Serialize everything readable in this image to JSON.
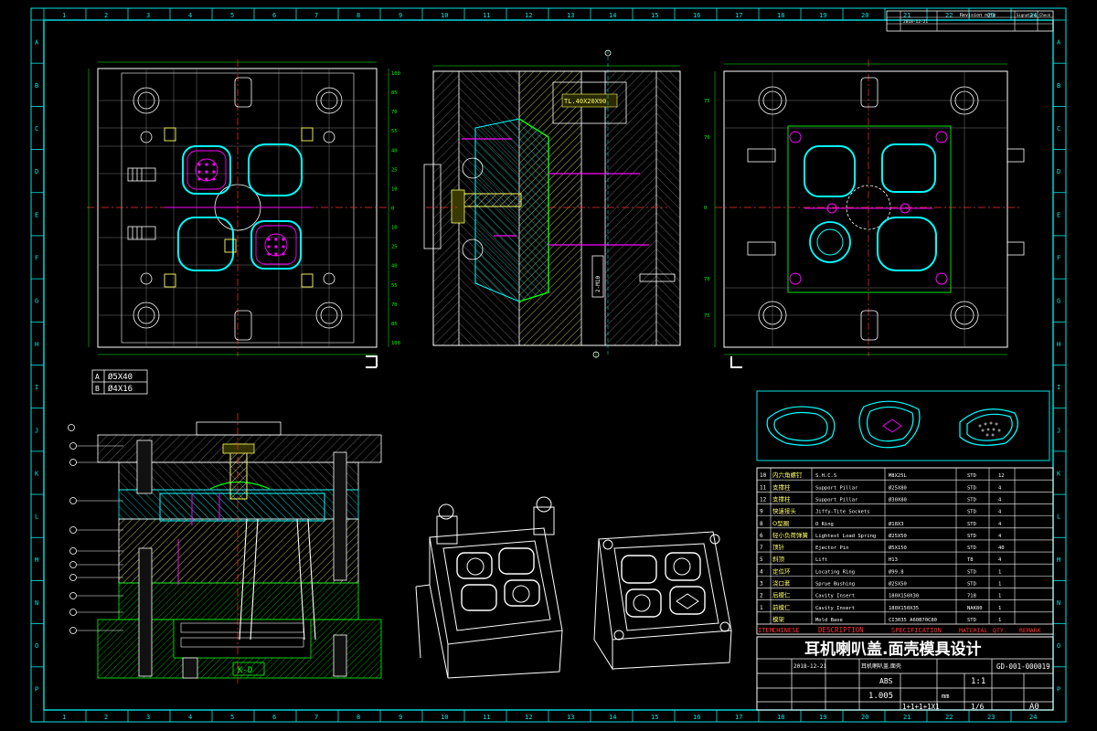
{
  "border": {
    "columns": [
      "1",
      "2",
      "3",
      "4",
      "5",
      "6",
      "7",
      "8",
      "9",
      "10",
      "11",
      "12",
      "13",
      "14",
      "15",
      "16",
      "17",
      "18",
      "19",
      "20",
      "21",
      "22",
      "23",
      "24"
    ],
    "rows": [
      "A",
      "B",
      "C",
      "D",
      "E",
      "F",
      "G",
      "H",
      "I",
      "J",
      "K",
      "L",
      "M",
      "N",
      "O",
      "P"
    ]
  },
  "views": {
    "plan_left": {
      "dims_right": [
        "100",
        "85",
        "70",
        "55",
        "40",
        "25",
        "10",
        "0",
        "10",
        "25",
        "40",
        "55",
        "70",
        "85",
        "100"
      ]
    },
    "plan_right": {
      "dims_left": [
        "75",
        "70",
        "0",
        "70",
        "75"
      ]
    },
    "section_top": {
      "part_labels": [
        "TL.40X20X90",
        "2-M10"
      ]
    },
    "section_lower": {
      "label": "K-D"
    }
  },
  "hole_table": [
    {
      "key": "A",
      "value": "Ø5X40"
    },
    {
      "key": "B",
      "value": "Ø4X16"
    }
  ],
  "bom": {
    "header": {
      "item": "ITEM",
      "chinese": "CHINESE",
      "description": "DESCRIPTION",
      "specification": "SPECIFICATION",
      "material": "MATERIAL",
      "qty": "QTY.",
      "remark": "REMARK"
    },
    "rows": [
      {
        "no": "10",
        "cn": "内六角螺钉",
        "desc": "S.H.C.S",
        "spec": "M8X25L",
        "mat": "STD",
        "qty": "12"
      },
      {
        "no": "11",
        "cn": "支撑柱",
        "desc": "Support Pillar",
        "spec": "Ø25X80",
        "mat": "STD",
        "qty": "4"
      },
      {
        "no": "12",
        "cn": "支撑柱",
        "desc": "Support Pillar",
        "spec": "Ø30X80",
        "mat": "STD",
        "qty": "4"
      },
      {
        "no": "9",
        "cn": "快速接头",
        "desc": "Jiffy-Tite Sockets",
        "spec": "",
        "mat": "STD",
        "qty": "4"
      },
      {
        "no": "8",
        "cn": "O型圈",
        "desc": "O Ring",
        "spec": "Ø18X3",
        "mat": "STD",
        "qty": "4"
      },
      {
        "no": "6",
        "cn": "轻小负荷弹簧",
        "desc": "Lightest Load Spring",
        "spec": "Ø25X50",
        "mat": "STD",
        "qty": "4"
      },
      {
        "no": "7",
        "cn": "顶针",
        "desc": "Ejector Pin",
        "spec": "Ø5X150",
        "mat": "STD",
        "qty": "40"
      },
      {
        "no": "5",
        "cn": "斜顶",
        "desc": "Lift",
        "spec": "H13",
        "mat": "T8",
        "qty": "4"
      },
      {
        "no": "4",
        "cn": "定位环",
        "desc": "Locating Ring",
        "spec": "Ø99.8",
        "mat": "STD",
        "qty": "1"
      },
      {
        "no": "3",
        "cn": "浇口套",
        "desc": "Sprue Bushing",
        "spec": "Ø25X50",
        "mat": "STD",
        "qty": "1"
      },
      {
        "no": "2",
        "cn": "后模仁",
        "desc": "Cavity Insert",
        "spec": "180X150X30",
        "mat": "718",
        "qty": "1"
      },
      {
        "no": "1",
        "cn": "前模仁",
        "desc": "Cavity Insert",
        "spec": "180X150X35",
        "mat": "NAK80",
        "qty": "1"
      },
      {
        "no": "",
        "cn": "模架",
        "desc": "Mold Base",
        "spec": "CI3035 A60B70C80",
        "mat": "STD",
        "qty": "1"
      }
    ]
  },
  "title_block": {
    "title": "耳机喇叭盖.面壳模具设计",
    "drawing_no": "GD-001-000019",
    "material": "ABS",
    "shrinkage": "1.005",
    "scale": "1:1",
    "unit": "mm",
    "cavity": "1+1+1+1X1",
    "sheet": "1/6",
    "size": "A0",
    "date": "2018-12-21",
    "part_name": "耳机喇叭盖.面壳"
  },
  "revision_block": {
    "date": "2018-12-21",
    "revision": "Revision note",
    "signature": "Signature",
    "check": "Check"
  },
  "colors": {
    "background": "#000000",
    "frame": "#00e5e5",
    "lines": "#ffffff",
    "dimension": "#00ff00",
    "hatch_core": "#00cccc",
    "hatch_cavity": "#ffff66",
    "part": "#00ffff",
    "ejector": "#ff00ff",
    "center_line": "#ff3030",
    "bom_header_text": "#ff3030",
    "title_text": "#ffffff"
  }
}
